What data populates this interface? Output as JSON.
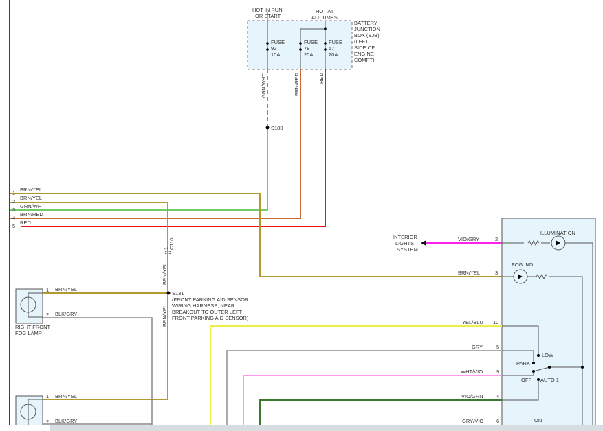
{
  "fuse_box": {
    "hot_run": [
      "HOT IN RUN",
      "OR START"
    ],
    "hot_all": [
      "HOT AT",
      "ALL TIMES"
    ],
    "name": [
      "BATTERY",
      "JUNCTION",
      "BOX (BJB)",
      "(LEFT",
      "SIDE OF",
      "ENGINE",
      "COMPT)"
    ],
    "fuses": [
      {
        "label": "FUSE",
        "num": "92",
        "amps": "10A"
      },
      {
        "label": "FUSE",
        "num": "78",
        "amps": "20A"
      },
      {
        "label": "FUSE",
        "num": "57",
        "amps": "20A"
      }
    ]
  },
  "vertical_wires": {
    "grn_wht": "GRN/WHT",
    "brn_red": "BRN/RED",
    "red": "RED",
    "s180": "S180",
    "c110": "C110",
    "c110_pin": "1",
    "brn_yel_a": "BRN/YEL",
    "brn_yel_b": "BRN/YEL"
  },
  "connector_rows": [
    {
      "pin": "1",
      "color": "BRN/YEL"
    },
    {
      "pin": "2",
      "color": "BRN/YEL"
    },
    {
      "pin": "3",
      "color": "GRN/WHT"
    },
    {
      "pin": "4",
      "color": "BRN/RED"
    },
    {
      "pin": "5",
      "color": "RED"
    }
  ],
  "splice_s131": {
    "id": "S131",
    "note": [
      "(FRONT PARKING AID SENSOR",
      "WIRING HARNESS, NEAR",
      "BREAKOUT TO OUTER LEFT",
      "FRONT PARKING AID SENSOR)"
    ]
  },
  "right_lamp": {
    "name": [
      "RIGHT FRONT",
      "FOG LAMP"
    ],
    "pins": [
      {
        "pin": "1",
        "color": "BRN/YEL"
      },
      {
        "pin": "2",
        "color": "BLK/GRY"
      }
    ]
  },
  "left_lamp": {
    "pins": [
      {
        "pin": "1",
        "color": "BRN/YEL"
      },
      {
        "pin": "2",
        "color": "BLK/GRY"
      }
    ]
  },
  "interior": [
    "INTERIOR",
    "LIGHTS",
    "SYSTEM"
  ],
  "switch": {
    "illumination": "ILLUMINATION",
    "fog_ind": "FOG IND",
    "low": "LOW",
    "park": "PARK",
    "off": "OFF",
    "auto": "AUTO 1",
    "on": "ON",
    "pins": [
      {
        "pin": "2",
        "color": "VIO/GRY"
      },
      {
        "pin": "3",
        "color": "BRN/YEL"
      },
      {
        "pin": "10",
        "color": "YEL/BLU"
      },
      {
        "pin": "5",
        "color": "GRY"
      },
      {
        "pin": "9",
        "color": "WHT/VIO"
      },
      {
        "pin": "4",
        "color": "VIO/GRN"
      },
      {
        "pin": "6",
        "color": "GRY/VIO"
      }
    ]
  },
  "colors": {
    "brn_yel": "#b39a2c",
    "grn": "#44bb33",
    "brn_red": "#c86a3a",
    "red": "#ee1111",
    "vio_gry": "#ff22ee",
    "yel_blu": "#eeee44",
    "gry": "#aaaaaa",
    "wht_vio": "#ff99ee",
    "vio_grn": "#3a7a2a",
    "box": "#e6f4fb"
  }
}
